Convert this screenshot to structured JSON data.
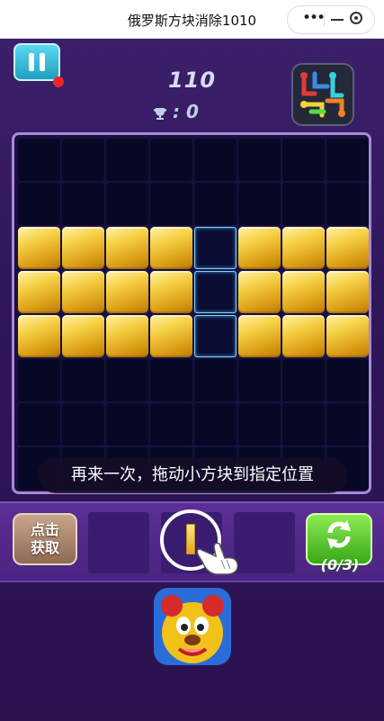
{
  "titlebar": {
    "title": "俄罗斯方块消除1010",
    "more_label": "•••"
  },
  "header": {
    "score": "110",
    "best_score": ": 0"
  },
  "board": {
    "rows": 8,
    "cols": 8,
    "grid": [
      "........",
      "........",
      "GGGGHGGG",
      "GGGGHGGG",
      "GGGGHGGG",
      "........",
      "........",
      "........"
    ]
  },
  "tip": "再来一次，拖动小方块到指定位置",
  "tray": {
    "get_button": [
      "点击",
      "获取"
    ],
    "refresh_count": "(0/3)"
  },
  "colors": {
    "gold": "#f6cf44",
    "hint_border": "#7fd7ff",
    "board_border": "#a58ad6"
  }
}
